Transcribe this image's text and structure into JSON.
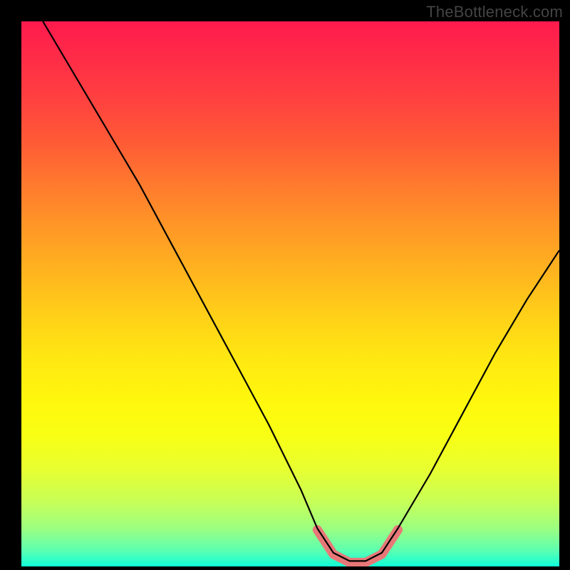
{
  "watermark": "TheBottleneck.com",
  "chart_data": {
    "type": "line",
    "title": "",
    "xlabel": "",
    "ylabel": "",
    "xlim": [
      0,
      100
    ],
    "ylim": [
      0,
      100
    ],
    "series": [
      {
        "name": "bottleneck-curve",
        "x": [
          4,
          10,
          16,
          22,
          28,
          34,
          40,
          46,
          52,
          55,
          58,
          61,
          64,
          67,
          70,
          76,
          82,
          88,
          94,
          100
        ],
        "y": [
          100,
          90,
          80,
          70,
          59,
          48,
          37,
          26,
          14,
          7,
          2.5,
          1,
          1,
          2.5,
          7,
          17,
          28,
          39,
          49,
          58
        ]
      }
    ],
    "annotations": [
      {
        "name": "valley-highlight",
        "x_range": [
          54,
          71
        ],
        "color": "#e87878"
      }
    ],
    "background_gradient": {
      "top": "#ff1a4d",
      "mid": "#fff80d",
      "bottom": "#10ffd8"
    }
  }
}
